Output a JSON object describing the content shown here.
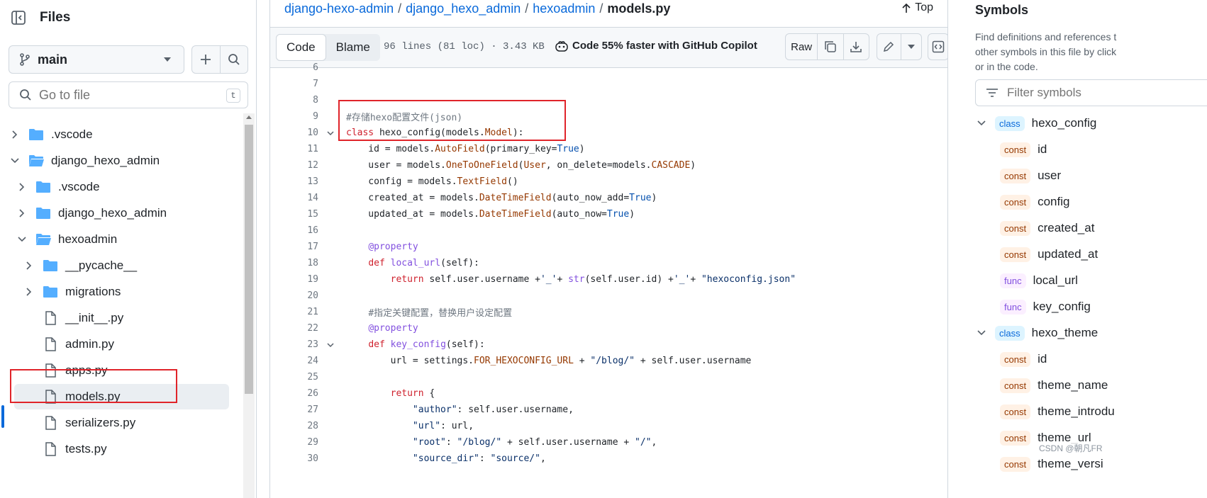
{
  "files_panel": {
    "title": "Files",
    "branch": "main",
    "search_placeholder": "Go to file",
    "search_shortcut": "t",
    "tree": [
      {
        "label": ".vscode",
        "type": "folder",
        "expanded": false,
        "depth": 0
      },
      {
        "label": "django_hexo_admin",
        "type": "folder",
        "expanded": true,
        "depth": 0
      },
      {
        "label": ".vscode",
        "type": "folder",
        "expanded": false,
        "depth": 1
      },
      {
        "label": "django_hexo_admin",
        "type": "folder",
        "expanded": false,
        "depth": 1
      },
      {
        "label": "hexoadmin",
        "type": "folder",
        "expanded": true,
        "depth": 1
      },
      {
        "label": "__pycache__",
        "type": "folder",
        "expanded": false,
        "depth": 2
      },
      {
        "label": "migrations",
        "type": "folder",
        "expanded": false,
        "depth": 2
      },
      {
        "label": "__init__.py",
        "type": "file",
        "depth": 2
      },
      {
        "label": "admin.py",
        "type": "file",
        "depth": 2
      },
      {
        "label": "apps.py",
        "type": "file",
        "depth": 2
      },
      {
        "label": "models.py",
        "type": "file",
        "depth": 2,
        "selected": true
      },
      {
        "label": "serializers.py",
        "type": "file",
        "depth": 2
      },
      {
        "label": "tests.py",
        "type": "file",
        "depth": 2
      }
    ]
  },
  "breadcrumb": {
    "repo": "django-hexo-admin",
    "dir1": "django_hexo_admin",
    "dir2": "hexoadmin",
    "file": "models.py"
  },
  "top_link": "Top",
  "toolbar": {
    "code_tab": "Code",
    "blame_tab": "Blame",
    "meta": "96 lines (81 loc) · 3.43 KB",
    "copilot": "Code 55% faster with GitHub Copilot",
    "raw": "Raw"
  },
  "code_lines": [
    {
      "n": "6",
      "html": ""
    },
    {
      "n": "7",
      "html": ""
    },
    {
      "n": "8",
      "html": ""
    },
    {
      "n": "9",
      "html": "<span class=\"cm\">#存储hexo配置文件(json)</span>"
    },
    {
      "n": "10",
      "fold": true,
      "html": "<span class=\"kw\">class</span> hexo_config(models.<span class=\"cl\">Model</span>):"
    },
    {
      "n": "11",
      "html": "    id = models.<span class=\"cl\">AutoField</span>(primary_key=<span class=\"nb\">True</span>)"
    },
    {
      "n": "12",
      "html": "    user = models.<span class=\"cl\">OneToOneField</span>(<span class=\"cl\">User</span>, on_delete=models.<span class=\"cl\">CASCADE</span>)"
    },
    {
      "n": "13",
      "html": "    config = models.<span class=\"cl\">TextField</span>()"
    },
    {
      "n": "14",
      "html": "    created_at = models.<span class=\"cl\">DateTimeField</span>(auto_now_add=<span class=\"nb\">True</span>)"
    },
    {
      "n": "15",
      "html": "    updated_at = models.<span class=\"cl\">DateTimeField</span>(auto_now=<span class=\"nb\">True</span>)"
    },
    {
      "n": "16",
      "html": ""
    },
    {
      "n": "17",
      "html": "    <span class=\"fn\">@property</span>"
    },
    {
      "n": "18",
      "html": "    <span class=\"kw\">def</span> <span class=\"fn\">local_url</span>(self):"
    },
    {
      "n": "19",
      "html": "        <span class=\"kw\">return</span> self.user.username +<span class=\"st\">'_'</span>+ <span class=\"fn\">str</span>(self.user.id) +<span class=\"st\">'_'</span>+ <span class=\"st\">\"hexoconfig.json\"</span>"
    },
    {
      "n": "20",
      "html": ""
    },
    {
      "n": "21",
      "html": "    <span class=\"cm\">#指定关键配置，替换用户设定配置</span>"
    },
    {
      "n": "22",
      "html": "    <span class=\"fn\">@property</span>"
    },
    {
      "n": "23",
      "fold": true,
      "html": "    <span class=\"kw\">def</span> <span class=\"fn\">key_config</span>(self):"
    },
    {
      "n": "24",
      "html": "        url = settings.<span class=\"cl\">FOR_HEXOCONFIG_URL</span> + <span class=\"st\">\"/blog/\"</span> + self.user.username"
    },
    {
      "n": "25",
      "html": ""
    },
    {
      "n": "26",
      "html": "        <span class=\"kw\">return</span> {"
    },
    {
      "n": "27",
      "html": "            <span class=\"st\">\"author\"</span>: self.user.username,"
    },
    {
      "n": "28",
      "html": "            <span class=\"st\">\"url\"</span>: url,"
    },
    {
      "n": "29",
      "html": "            <span class=\"st\">\"root\"</span>: <span class=\"st\">\"/blog/\"</span> + self.user.username + <span class=\"st\">\"/\"</span>,"
    },
    {
      "n": "30",
      "html": "            <span class=\"st\">\"source_dir\"</span>: <span class=\"st\">\"source/\"</span>,"
    }
  ],
  "symbols": {
    "title": "Symbols",
    "desc": [
      "Find definitions and references t",
      "other symbols in this file by click",
      "or in the code."
    ],
    "filter_placeholder": "Filter symbols",
    "items": [
      {
        "kind": "class",
        "name": "hexo_config",
        "depth": 0
      },
      {
        "kind": "const",
        "name": "id",
        "depth": 1
      },
      {
        "kind": "const",
        "name": "user",
        "depth": 1
      },
      {
        "kind": "const",
        "name": "config",
        "depth": 1
      },
      {
        "kind": "const",
        "name": "created_at",
        "depth": 1
      },
      {
        "kind": "const",
        "name": "updated_at",
        "depth": 1
      },
      {
        "kind": "func",
        "name": "local_url",
        "depth": 1
      },
      {
        "kind": "func",
        "name": "key_config",
        "depth": 1
      },
      {
        "kind": "class",
        "name": "hexo_theme",
        "depth": 0
      },
      {
        "kind": "const",
        "name": "id",
        "depth": 1
      },
      {
        "kind": "const",
        "name": "theme_name",
        "depth": 1
      },
      {
        "kind": "const",
        "name": "theme_introdu",
        "depth": 1
      },
      {
        "kind": "const",
        "name": "theme_url",
        "depth": 1
      },
      {
        "kind": "const",
        "name": "theme_versi",
        "depth": 1
      }
    ]
  },
  "watermark": "CSDN @朝凡FR"
}
